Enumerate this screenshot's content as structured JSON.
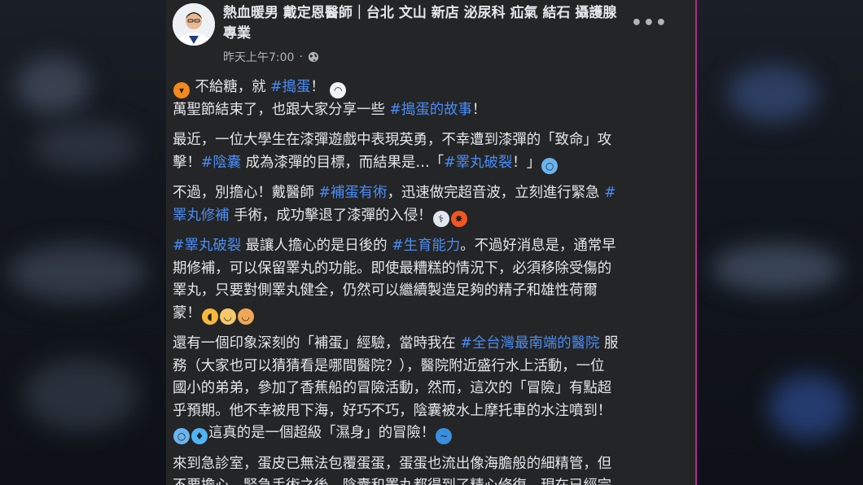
{
  "post": {
    "author": "熱血暖男 戴定恩醫師｜台北 文山 新店 泌尿科 疝氣 結石 攝護腺專業",
    "time": "昨天上午7:00",
    "more_label": "•••",
    "paragraphs": [
      {
        "lines": [
          [
            {
              "emoji": "pumpkin"
            },
            {
              "t": " 不給糖，就 "
            },
            {
              "tag": "#搗蛋"
            },
            {
              "t": "！ "
            },
            {
              "emoji": "ghost"
            }
          ],
          [
            {
              "t": "萬聖節結束了，也跟大家分享一些 "
            },
            {
              "tag": "#搗蛋的故事"
            },
            {
              "t": "！"
            }
          ]
        ]
      },
      {
        "lines": [
          [
            {
              "t": "最近，一位大學生在漆彈遊戲中表現英勇，不幸遭到漆彈的「致命」攻"
            }
          ],
          [
            {
              "t": "擊！"
            },
            {
              "tag": "#陰囊"
            },
            {
              "t": " 成為漆彈的目標，而結果是…「"
            },
            {
              "tag": "#睪丸破裂"
            },
            {
              "t": "！」"
            },
            {
              "emoji": "scream"
            }
          ]
        ]
      },
      {
        "lines": [
          [
            {
              "t": "不過，別擔心！戴醫師 "
            },
            {
              "tag": "#補蛋有術"
            },
            {
              "t": "，迅速做完超音波，立刻進行緊急 "
            },
            {
              "tag": "#"
            }
          ],
          [
            {
              "tag": "睪丸修補"
            },
            {
              "t": " 手術，成功擊退了漆彈的入侵！"
            },
            {
              "emoji": "doctor"
            },
            {
              "emoji": "collision"
            }
          ]
        ]
      },
      {
        "lines": [
          [
            {
              "tag": "#睪丸破裂"
            },
            {
              "t": " 最讓人擔心的是日後的 "
            },
            {
              "tag": "#生育能力"
            },
            {
              "t": "。不過好消息是，通常早"
            }
          ],
          [
            {
              "t": "期修補，可以保留睪丸的功能。即使最糟糕的情況下，必須移除受傷的"
            }
          ],
          [
            {
              "t": "睪丸，只要對側睪丸健全，仍然可以繼續製造足夠的精子和雄性荷爾"
            }
          ],
          [
            {
              "t": "蒙！"
            },
            {
              "emoji": "muscle"
            },
            {
              "emoji": "baby"
            },
            {
              "emoji": "man"
            }
          ]
        ]
      },
      {
        "lines": [
          [
            {
              "t": "還有一個印象深刻的「補蛋」經驗，當時我在 "
            },
            {
              "tag": "#全台灣最南端的醫院"
            },
            {
              "t": " 服"
            }
          ],
          [
            {
              "t": "務（大家也可以猜猜看是哪間醫院？），醫院附近盛行水上活動，一位"
            }
          ],
          [
            {
              "t": "國小的弟弟，參加了香蕉船的冒險活動，然而，這次的「冒險」有點超"
            }
          ],
          [
            {
              "t": "乎預期。他不幸被甩下海，好巧不巧，陰囊被水上摩托車的水注噴到！"
            }
          ],
          [
            {
              "emoji": "scream"
            },
            {
              "emoji": "droplets"
            },
            {
              "t": "這真的是一個超級「濕身」的冒險！"
            },
            {
              "emoji": "wave"
            }
          ]
        ]
      },
      {
        "lines": [
          [
            {
              "t": "來到急診室，蛋皮已無法包覆蛋蛋，蛋蛋也流出像海膽般的細精管，但"
            }
          ],
          [
            {
              "t": "不要擔心，緊急手術之後，陰囊和睪丸都得到了精心修復，現在已經完"
            }
          ]
        ]
      }
    ]
  },
  "colors": {
    "card_bg": "#242526",
    "text": "#e4e6eb",
    "secondary_text": "#b0b3b8",
    "hashtag": "#4a8cf5"
  },
  "emoji_colors": {
    "pumpkin": "#f28a1e",
    "ghost": "#f2f2f2",
    "scream": "#6ab4f0",
    "doctor": "#dfe6ee",
    "collision": "#f4561f",
    "muscle": "#f6b93b",
    "baby": "#f7c86b",
    "man": "#f0a856",
    "droplets": "#4fb3f4",
    "wave": "#3a8fe0"
  },
  "emoji_glyphs": {
    "pumpkin": "▾",
    "ghost": "◠",
    "scream": "○",
    "doctor": "⚕",
    "collision": "✸",
    "muscle": "◖",
    "baby": "◡",
    "man": "◡",
    "droplets": "♦",
    "wave": "~"
  }
}
